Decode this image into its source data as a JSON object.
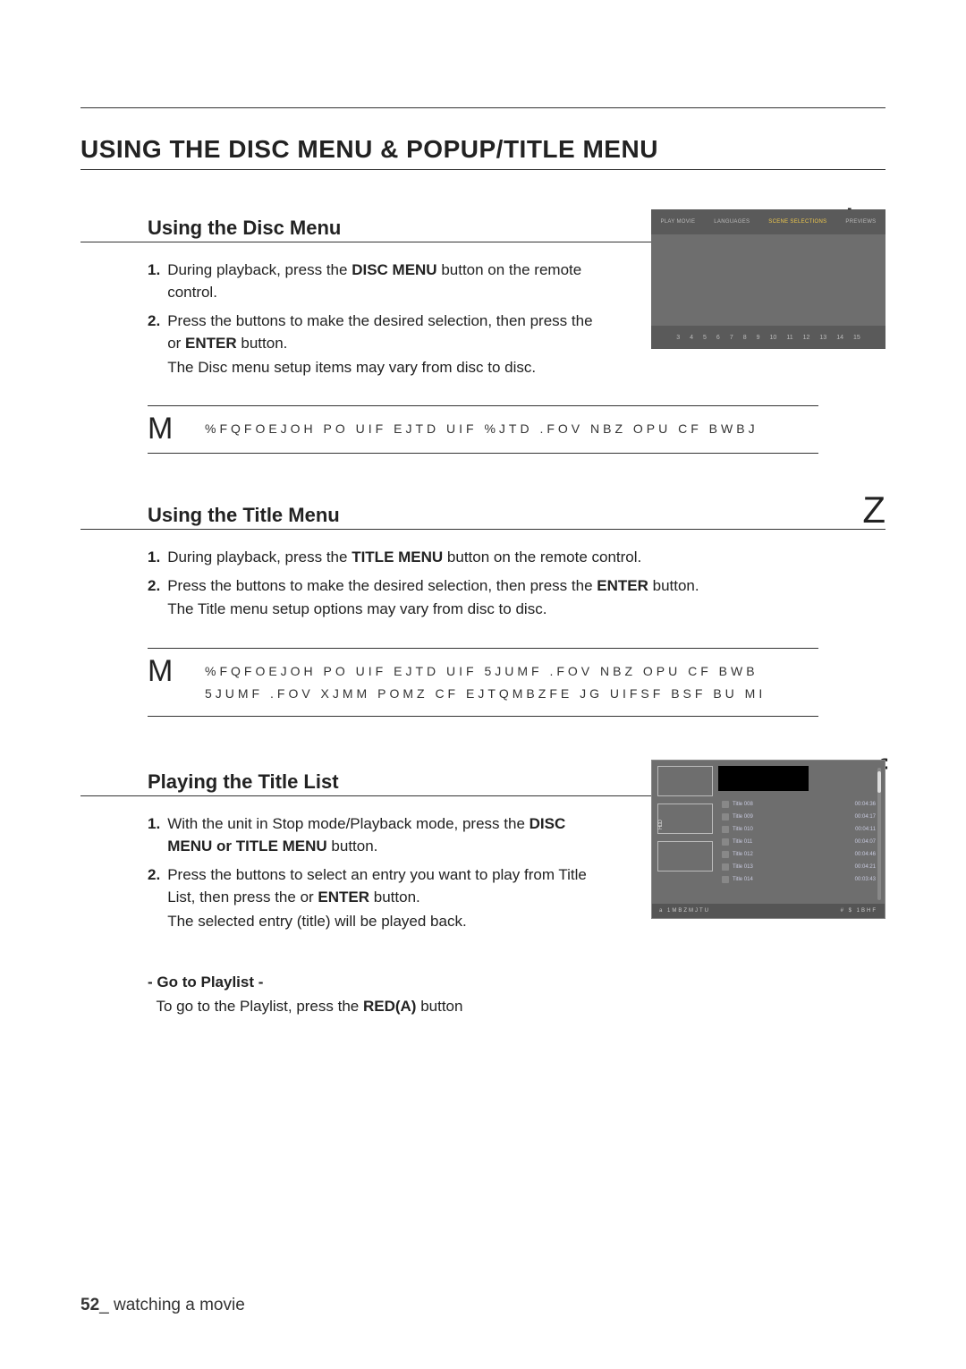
{
  "page": {
    "number": "52",
    "footer_label": "_ watching a movie"
  },
  "main_heading": "USING THE DISC MENU & POPUP/TITLE MENU",
  "section_disc": {
    "title": "Using the Disc Menu",
    "glyph": "hZ",
    "step1_a": "During playback, press the ",
    "step1_bold": "DISC MENU",
    "step1_b": " button on the remote control.",
    "step2_a": "Press the ",
    "step2_gap": "          ",
    "step2_b": " buttons to make the desired selection, then press the ",
    "step2_gap2": "   ",
    "step2_c": " or ",
    "step2_bold": "ENTER",
    "step2_d": " button.",
    "step2_sub": "The Disc menu setup items may vary from disc to disc."
  },
  "note1": {
    "glyph": "M",
    "line1": "%FQFOEJOH PO UIF EJTD  UIF %JTD .FOV NBZ OPU CF BWBJ"
  },
  "section_titlemenu": {
    "title": "Using the Title Menu",
    "glyph": "Z",
    "step1_a": "During playback, press the ",
    "step1_bold": "TITLE MENU",
    "step1_b": " button on the remote control.",
    "step2_a": "Press the ",
    "step2_gap": "            ",
    "step2_b": " buttons to make the desired selection, then press the ",
    "step2_bold": "ENTER",
    "step2_c": " button.",
    "step2_sub": "The Title menu setup options may vary from disc to disc."
  },
  "note2": {
    "glyph": "M",
    "line1": "%FQFOEJOH PO UIF EJTD  UIF 5JUMF .FOV NBZ OPU CF BWB",
    "line2": "5JUMF .FOV XJMM POMZ CF EJTQMBZFE JG UIFSF BSF BU MI"
  },
  "section_titlelist": {
    "title": "Playing the Title List",
    "glyph": "gf",
    "step1_a": "With the unit in Stop mode/Playback mode, press the ",
    "step1_bold": "DISC MENU or TITLE MENU",
    "step1_b": " button.",
    "step2_a": "Press the ",
    "step2_gap": "      ",
    "step2_b": " buttons to select an entry you want to play from Title List, then press the ",
    "step2_gap2": "   ",
    "step2_c": " or ",
    "step2_bold": "ENTER",
    "step2_d": " button.",
    "step2_sub": "The selected entry (title) will be played back."
  },
  "goto": {
    "head": "- Go to Playlist -",
    "body_a": "To go to the Playlist, press the ",
    "body_bold": "RED(A)",
    "body_b": " button"
  },
  "disc_screen": {
    "bar": [
      "PLAY MOVIE",
      "LANGUAGES",
      "SCENE SELECTIONS",
      "PREVIEWS"
    ],
    "foot": [
      "3",
      "4",
      "5",
      "6",
      "7",
      "8",
      "9",
      "10",
      "11",
      "12",
      "13",
      "14",
      "15"
    ]
  },
  "title_screen": {
    "side_label": "HDD",
    "rows": [
      {
        "t": "Title 008",
        "d": "00:04:36"
      },
      {
        "t": "Title 009",
        "d": "00:04:17"
      },
      {
        "t": "Title 010",
        "d": "00:04:11"
      },
      {
        "t": "Title 011",
        "d": "00:04:07"
      },
      {
        "t": "Title 012",
        "d": "00:04:46"
      },
      {
        "t": "Title 013",
        "d": "00:04:21"
      },
      {
        "t": "Title 014",
        "d": "00:03:43"
      }
    ],
    "bottom_left": "a  1MBZMJTU",
    "bottom_right": "#  $  1BHF"
  }
}
